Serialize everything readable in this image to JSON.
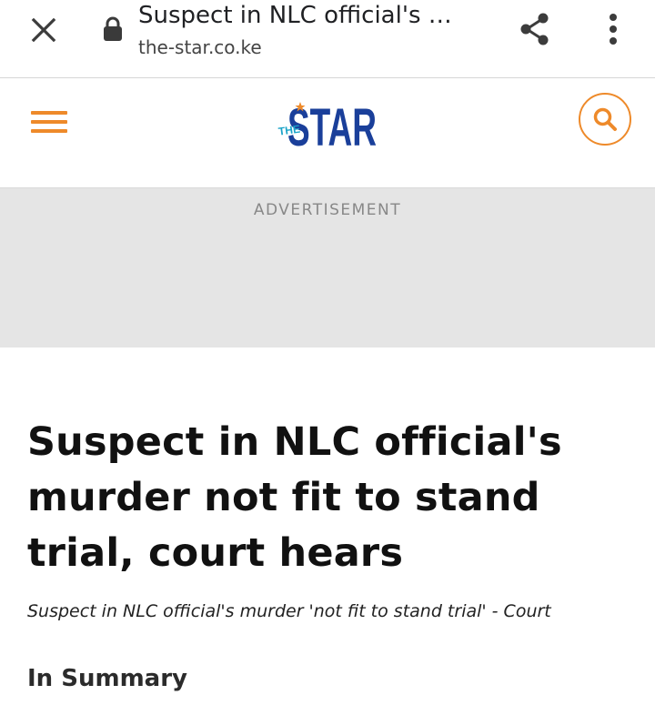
{
  "browser": {
    "tab_title": "Suspect in NLC official's …",
    "url": "the-star.co.ke",
    "icons": {
      "close": "close-icon",
      "lock": "lock-icon",
      "share": "share-icon",
      "more": "more-vert-icon"
    }
  },
  "site_header": {
    "logo_main": "STAR",
    "logo_prefix": "THE",
    "icons": {
      "menu": "hamburger-menu-icon",
      "search": "search-icon"
    },
    "colors": {
      "accent": "#ee8a2a",
      "logo_blue": "#1a3f9a",
      "logo_teal": "#1aa3c8"
    }
  },
  "ad": {
    "label": "ADVERTISEMENT"
  },
  "article": {
    "headline_lines": [
      "Suspect in NLC official's",
      "murder not fit to stand",
      "trial, court hears"
    ],
    "subtitle": "Suspect in NLC official's murder 'not fit to stand trial' - Court",
    "summary_heading": "In Summary"
  }
}
